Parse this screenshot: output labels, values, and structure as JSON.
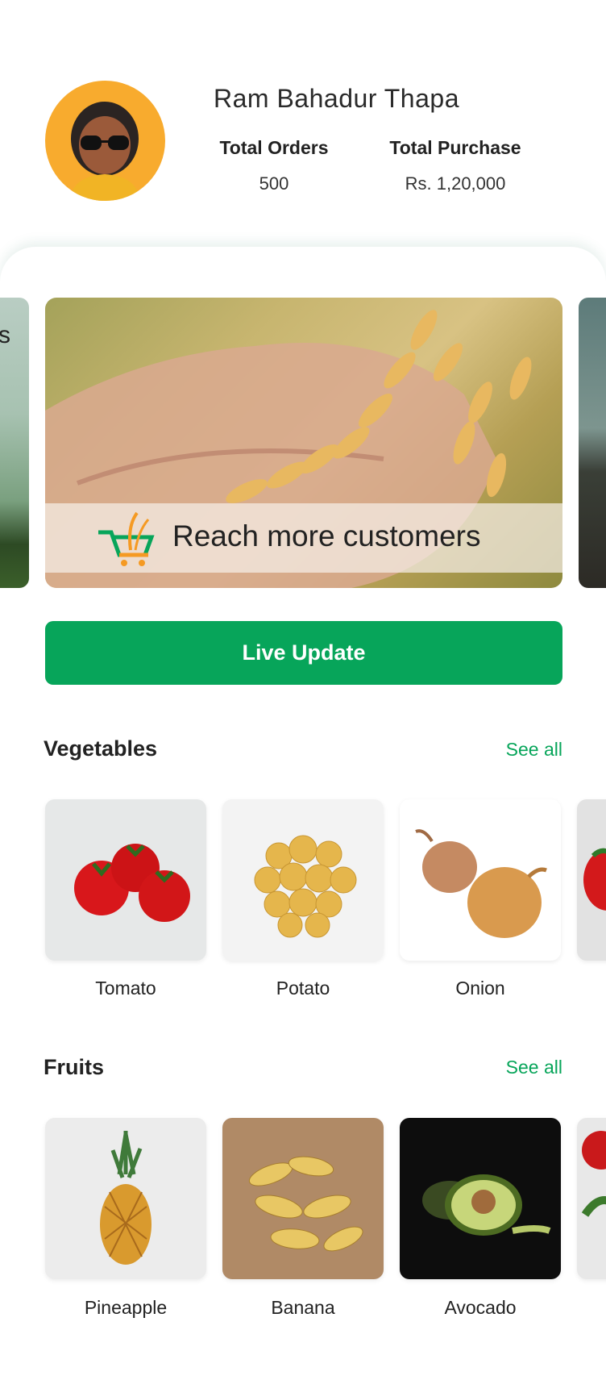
{
  "profile": {
    "name": "Ram Bahadur Thapa",
    "orders_label": "Total Orders",
    "orders_value": "500",
    "purchase_label": "Total Purchase",
    "purchase_value": "Rs. 1,20,000"
  },
  "carousel": {
    "left_peek_text": "s",
    "banner_text": "Reach more customers"
  },
  "live_button": "Live Update",
  "vegetables": {
    "title": "Vegetables",
    "see_all": "See all",
    "items": [
      "Tomato",
      "Potato",
      "Onion"
    ]
  },
  "fruits": {
    "title": "Fruits",
    "see_all": "See all",
    "items": [
      "Pineapple",
      "Banana",
      "Avocado"
    ]
  },
  "colors": {
    "accent": "#07a55a",
    "avatar_bg": "#f8ab2e"
  }
}
